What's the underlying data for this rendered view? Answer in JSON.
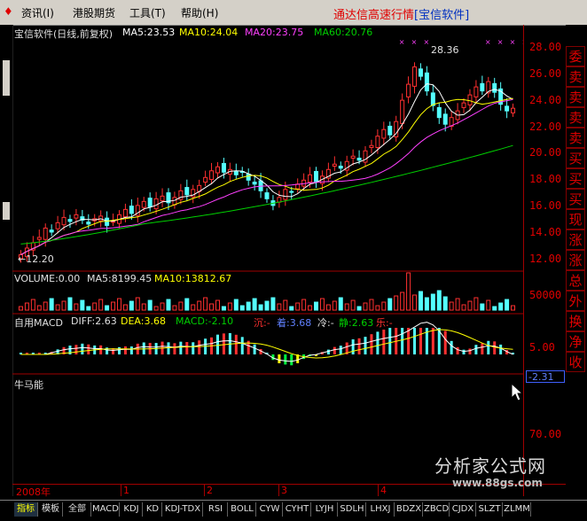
{
  "menu": {
    "items": [
      "资讯(I)",
      "港股期货",
      "工具(T)",
      "帮助(H)"
    ],
    "brand_main": "通达信高速行情",
    "brand_sub": "[宝信软件]"
  },
  "main_panel": {
    "title": "宝信软件(日线,前复权)",
    "ma5": "MA5:23.53",
    "ma10": "MA10:24.04",
    "ma20": "MA20:23.75",
    "ma60": "MA60:20.76",
    "high_label": "28.36",
    "low_label": "←12.20",
    "y_ticks": [
      "28.00",
      "26.00",
      "24.00",
      "22.00",
      "20.00",
      "18.00",
      "16.00",
      "14.00",
      "12.00"
    ]
  },
  "volume_panel": {
    "volume": "VOLUME:0.00",
    "ma5": "MA5:8199.45",
    "ma10": "MA10:13812.67",
    "y_tick": "50000"
  },
  "macd_panel": {
    "name": "自用MACD",
    "diff": "DIFF:2.63",
    "dea": "DEA:3.68",
    "macd": "MACD:-2.10",
    "chen": "沉:-",
    "zhuo": "着:3.68",
    "leng": "冷:-",
    "jing": "静:2.63",
    "le": "乐:-",
    "y_tick": "5.00",
    "current": "-2.31"
  },
  "niuma_panel": {
    "name": "牛马能",
    "y_tick": "70.00"
  },
  "date_axis": {
    "year": "2008年",
    "months": [
      "1",
      "2",
      "3",
      "4"
    ]
  },
  "right_tabs": [
    "委",
    "卖",
    "卖",
    "卖",
    "卖",
    "买",
    "买",
    "买",
    "现",
    "涨",
    "涨",
    "总",
    "外",
    "换",
    "净",
    "收"
  ],
  "bottom_tabs": [
    "指标",
    "模板",
    "全部",
    "MACD",
    "KDJ",
    "KD",
    "KDJ-TDX",
    "RSI",
    "BOLL",
    "CYW",
    "CYHT",
    "LYJH",
    "SDLH",
    "LHXJ",
    "BDZX",
    "ZBCD",
    "CJDX",
    "SLZT",
    "ZLMM"
  ],
  "watermark": {
    "line1": "分析家公式网",
    "line2": "www.88gs.com"
  },
  "colors": {
    "up": "#ff3030",
    "down": "#54ffff",
    "ma5": "#ffffff",
    "ma10": "#ffff00",
    "ma20": "#ff40ff",
    "ma60": "#00d000",
    "axis": "#e00000"
  },
  "chart_data": {
    "type": "line",
    "closes": [
      12.6,
      13.1,
      13.5,
      13.9,
      14.6,
      14.3,
      15.0,
      15.4,
      15.1,
      15.6,
      15.2,
      14.9,
      15.3,
      15.5,
      14.8,
      15.1,
      15.6,
      16.0,
      15.7,
      16.3,
      16.6,
      16.2,
      16.8,
      17.0,
      16.5,
      16.9,
      17.4,
      17.1,
      17.5,
      17.8,
      18.4,
      18.9,
      19.2,
      18.8,
      19.0,
      18.6,
      18.8,
      18.2,
      17.9,
      17.4,
      16.8,
      16.3,
      16.9,
      17.5,
      17.3,
      17.9,
      18.2,
      18.6,
      18.1,
      18.5,
      19.0,
      19.4,
      19.1,
      19.6,
      20.0,
      19.7,
      20.4,
      20.8,
      21.5,
      22.0,
      21.6,
      22.6,
      24.2,
      25.4,
      26.7,
      26.0,
      24.9,
      23.8,
      22.9,
      22.4,
      22.9,
      23.4,
      24.0,
      24.6,
      25.2,
      24.9,
      25.6,
      24.8,
      23.9,
      23.4,
      23.6
    ],
    "ylim": [
      11.5,
      28.8
    ],
    "ticks": [
      28,
      26,
      24,
      22,
      20,
      18,
      16,
      14,
      12
    ]
  }
}
